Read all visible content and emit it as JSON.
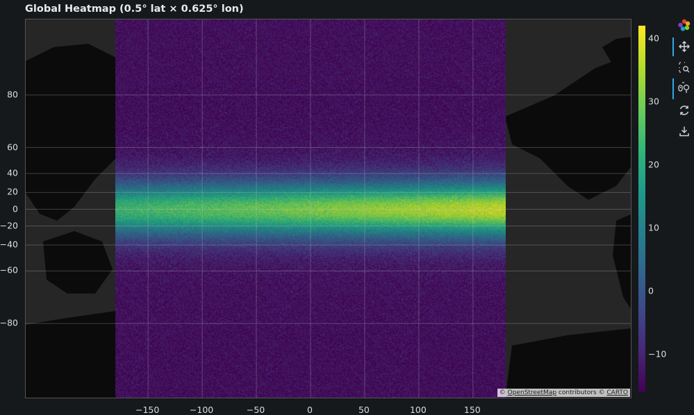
{
  "title": "Global Heatmap (0.5° lat × 0.625° lon)",
  "attribution": {
    "prefix": "© ",
    "osm": "OpenStreetMap",
    "middle": " contributors © ",
    "carto": "CARTO"
  },
  "toolbar": [
    {
      "icon": "bokeh-logo-icon",
      "active": false
    },
    {
      "icon": "pan-icon",
      "active": true
    },
    {
      "icon": "box-zoom-icon",
      "active": false
    },
    {
      "icon": "wheel-zoom-icon",
      "active": true
    },
    {
      "icon": "reset-icon",
      "active": false
    },
    {
      "icon": "save-icon",
      "active": false
    }
  ],
  "chart_data": {
    "type": "heatmap",
    "title": "Global Heatmap (0.5° lat × 0.625° lon)",
    "xlabel": "",
    "ylabel": "",
    "x_ticks": [
      -150,
      -100,
      -50,
      0,
      50,
      100,
      150
    ],
    "y_ticks": [
      80,
      60,
      40,
      20,
      0,
      -20,
      -40,
      -60,
      -80
    ],
    "xlim": [
      -263,
      297
    ],
    "ylim": [
      -88,
      88
    ],
    "x_scale": "linear",
    "y_scale": "web-mercator",
    "data_extent": {
      "lon": [
        -180,
        180
      ],
      "lat": [
        -90,
        90
      ]
    },
    "cell_size": {
      "lat": 0.5,
      "lon": 0.625
    },
    "colormap": "viridis",
    "color_range": [
      -16,
      42
    ],
    "colorbar_ticks": [
      40,
      30,
      20,
      10,
      0,
      -10
    ],
    "grid": true,
    "basemap": "CARTO dark",
    "pattern": "values highest near equator (~35-42 at lon 60-180), decreasing toward the poles (~-15)"
  }
}
